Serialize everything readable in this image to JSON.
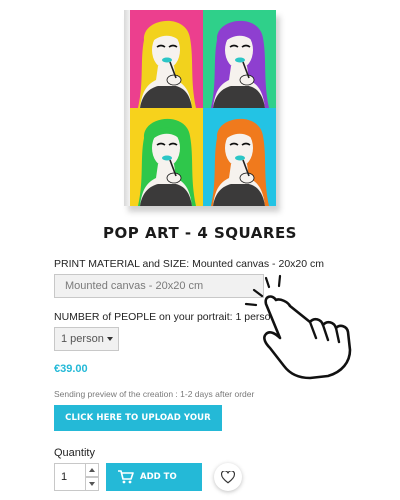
{
  "product": {
    "title": "POP ART - 4 SQUARES",
    "image_alt": "pop-art-4-squares-canvas",
    "tile_colors": [
      "#ec3f8e",
      "#2fd08a",
      "#f7d21c",
      "#23c3e4"
    ],
    "hair_colors": [
      "#f2d21d",
      "#8e3fd0",
      "#2fc74b",
      "#f07a1d"
    ]
  },
  "options": {
    "material_label": "PRINT MATERIAL and SIZE: Mounted canvas - 20x20 cm",
    "material_value": "Mounted canvas - 20x20 cm",
    "people_label": "NUMBER of PEOPLE on your portrait: 1 person",
    "people_value": "1 person"
  },
  "price": "€39.00",
  "preview_note": "Sending preview of the creation : 1-2 days after order",
  "upload_button": "CLICK HERE TO UPLOAD YOUR PHOTOS",
  "quantity": {
    "label": "Quantity",
    "value": "1"
  },
  "cart_button": "ADD TO CART",
  "icons": {
    "cart": "cart-icon",
    "wishlist": "heart-icon",
    "pointer": "pointing-hand-icon"
  },
  "colors": {
    "accent": "#24b9d7"
  }
}
